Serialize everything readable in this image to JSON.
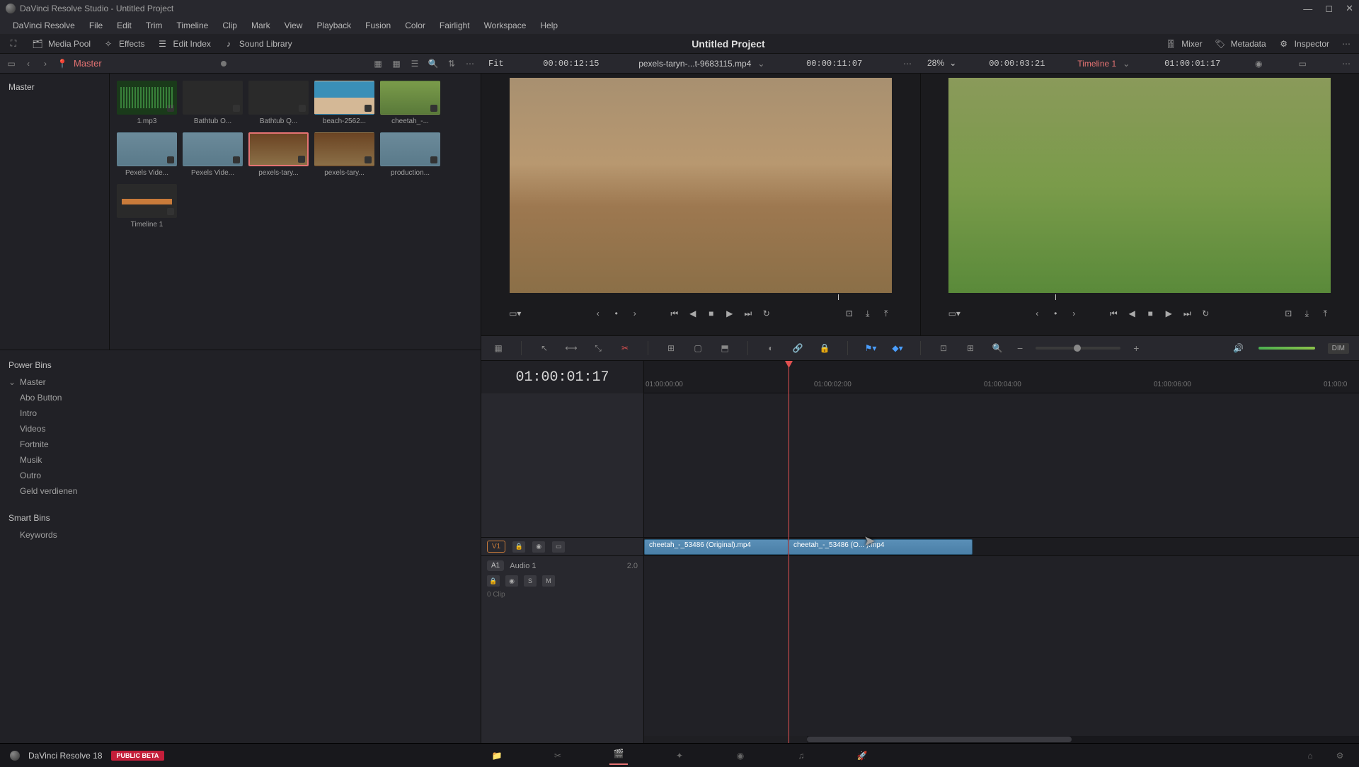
{
  "window": {
    "title": "DaVinci Resolve Studio - Untitled Project"
  },
  "menu": [
    "DaVinci Resolve",
    "File",
    "Edit",
    "Trim",
    "Timeline",
    "Clip",
    "Mark",
    "View",
    "Playback",
    "Fusion",
    "Color",
    "Fairlight",
    "Workspace",
    "Help"
  ],
  "toolbar": {
    "media_pool": "Media Pool",
    "effects": "Effects",
    "edit_index": "Edit Index",
    "sound_library": "Sound Library",
    "mixer": "Mixer",
    "metadata": "Metadata",
    "inspector": "Inspector"
  },
  "project_name": "Untitled Project",
  "subbar": {
    "master": "Master",
    "source_fit": "Fit",
    "source_tc_left": "00:00:12:15",
    "source_name": "pexels-taryn-...t-9683115.mp4",
    "source_tc_right": "00:00:11:07",
    "program_zoom": "28%",
    "program_tc_left": "00:00:03:21",
    "timeline_name": "Timeline 1",
    "program_tc_right": "01:00:01:17"
  },
  "master_bin_label": "Master",
  "clips": [
    {
      "name": "1.mp3",
      "kind": "audio"
    },
    {
      "name": "Bathtub O...",
      "kind": "dark"
    },
    {
      "name": "Bathtub Q...",
      "kind": "dark"
    },
    {
      "name": "beach-2562...",
      "kind": "beach"
    },
    {
      "name": "cheetah_-...",
      "kind": "cheetah"
    },
    {
      "name": "Pexels Vide...",
      "kind": "water"
    },
    {
      "name": "Pexels Vide...",
      "kind": "water"
    },
    {
      "name": "pexels-tary...",
      "kind": "forest",
      "selected": true
    },
    {
      "name": "pexels-tary...",
      "kind": "forest"
    },
    {
      "name": "production...",
      "kind": "water"
    },
    {
      "name": "Timeline 1",
      "kind": "timeline"
    }
  ],
  "power_bins": {
    "label": "Power Bins",
    "root": "Master",
    "items": [
      "Abo Button",
      "Intro",
      "Videos",
      "Fortnite",
      "Musik",
      "Outro",
      "Geld verdienen"
    ]
  },
  "smart_bins": {
    "label": "Smart Bins",
    "items": [
      "Keywords"
    ]
  },
  "timeline": {
    "current_tc": "01:00:01:17",
    "ruler": [
      "01:00:00:00",
      "01:00:02:00",
      "01:00:04:00",
      "01:00:06:00",
      "01:00:0"
    ],
    "v1_label": "V1",
    "a1_label": "A1",
    "a1_name": "Audio 1",
    "a1_level": "2.0",
    "a1_clipcount": "0 Clip",
    "clip1": "cheetah_-_53486 (Original).mp4",
    "clip2": "cheetah_-_53486 (O...    ).mp4",
    "track_btns": {
      "s": "S",
      "m": "M"
    }
  },
  "footer": {
    "app": "DaVinci Resolve 18",
    "beta": "PUBLIC BETA"
  },
  "dim_label": "DIM"
}
